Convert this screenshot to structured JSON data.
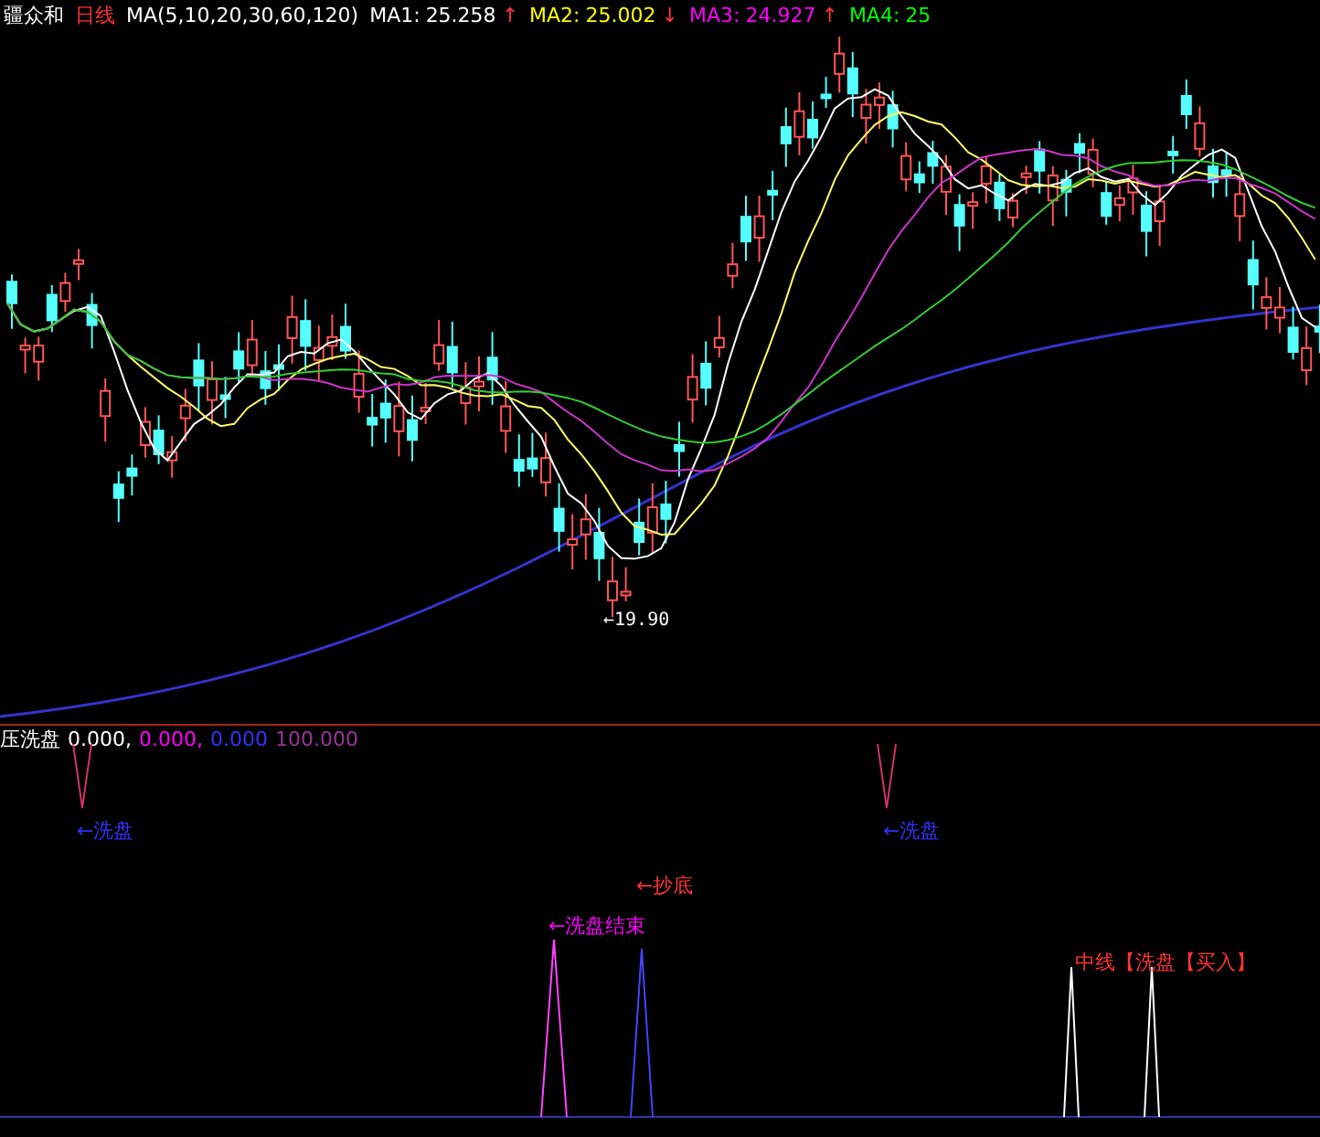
{
  "header": {
    "stock": "疆众和",
    "period": "日线",
    "ma_params": "MA(5,10,20,30,60,120)",
    "ma_readings": [
      {
        "label": "MA1:",
        "value": "25.258",
        "arrow": "↑",
        "color": "#ffffff"
      },
      {
        "label": "MA2:",
        "value": "25.002",
        "arrow": "↓",
        "color": "#ffff00"
      },
      {
        "label": "MA3:",
        "value": "24.927",
        "arrow": "↑",
        "color": "#ff00ff"
      },
      {
        "label": "MA4:",
        "value": "25",
        "color": "#00ff00"
      }
    ]
  },
  "price_chart": {
    "low_label": "←19.90"
  },
  "indicator": {
    "name": "压洗盘",
    "readings": [
      {
        "value": "0.000,",
        "color": "#ffffff"
      },
      {
        "value": "0.000,",
        "color": "#ff00ff"
      },
      {
        "value": "0.000",
        "color": "#3333ff"
      },
      {
        "value": "100.000",
        "color": "#993399"
      }
    ],
    "signals": [
      {
        "text": "←洗盘",
        "color": "#3333ff"
      },
      {
        "text": "←洗盘",
        "color": "#3333ff"
      }
    ]
  },
  "signal_panel": {
    "signals": [
      {
        "text": "←抄底",
        "color": "#ff3333"
      },
      {
        "text": "←洗盘结束",
        "color": "#ff00ff"
      },
      {
        "text": "中线【洗盘【买入】",
        "color": "#ff3333"
      }
    ]
  }
}
